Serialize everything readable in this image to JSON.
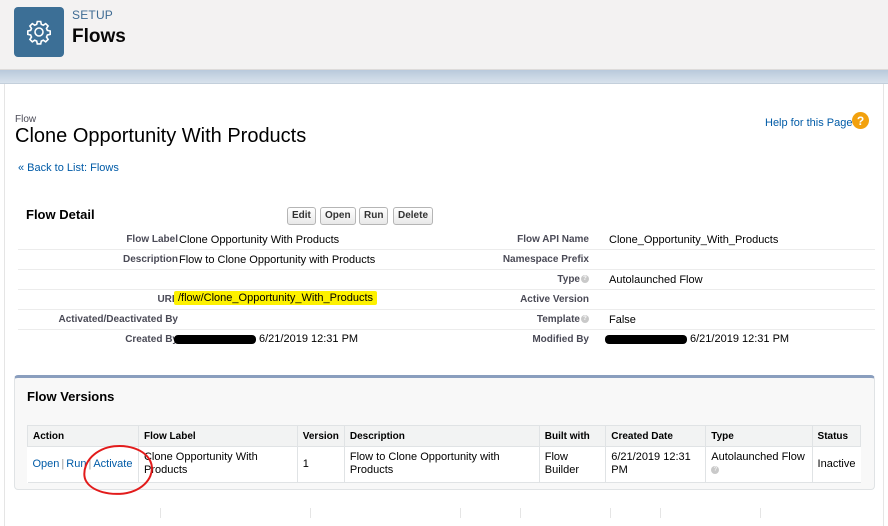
{
  "header": {
    "eyebrow": "SETUP",
    "title": "Flows",
    "icon": "gear-icon",
    "icon_bg": "#3c6f96"
  },
  "page": {
    "crumb_label": "Flow",
    "title": "Clone Opportunity With Products",
    "help_link": "Help for this Page",
    "help_icon": "?",
    "back_link": "« Back to List: Flows"
  },
  "detail": {
    "title": "Flow Detail",
    "buttons": {
      "edit": "Edit",
      "open": "Open",
      "run": "Run",
      "delete": "Delete"
    },
    "fields": {
      "flow_label": {
        "label": "Flow Label",
        "value": "Clone Opportunity With Products"
      },
      "flow_api_name": {
        "label": "Flow API Name",
        "value": "Clone_Opportunity_With_Products"
      },
      "description": {
        "label": "Description",
        "value": "Flow to Clone Opportunity with Products"
      },
      "namespace_prefix": {
        "label": "Namespace Prefix",
        "value": ""
      },
      "type": {
        "label": "Type",
        "value": "Autolaunched Flow"
      },
      "url": {
        "label": "URL",
        "value": "/flow/Clone_Opportunity_With_Products"
      },
      "active_version": {
        "label": "Active Version",
        "value": ""
      },
      "activated_by": {
        "label": "Activated/Deactivated By",
        "value": ""
      },
      "template": {
        "label": "Template",
        "value": "False"
      },
      "created_by": {
        "label": "Created By",
        "value": "6/21/2019 12:31 PM"
      },
      "modified_by": {
        "label": "Modified By",
        "value": "6/21/2019 12:31 PM"
      }
    },
    "highlight_color": "#fdf100"
  },
  "versions": {
    "title": "Flow Versions",
    "columns": [
      "Action",
      "Flow Label",
      "Version",
      "Description",
      "Built with",
      "Created Date",
      "Type",
      "Status"
    ],
    "rows": [
      {
        "actions": {
          "open": "Open",
          "run": "Run",
          "activate": "Activate"
        },
        "flow_label": "Clone Opportunity With Products",
        "version": "1",
        "description": "Flow to Clone Opportunity with Products",
        "built_with": "Flow Builder",
        "created_date": "6/21/2019 12:31 PM",
        "type": "Autolaunched Flow",
        "status": "Inactive"
      }
    ],
    "annotation_color": "#e21b1b"
  }
}
